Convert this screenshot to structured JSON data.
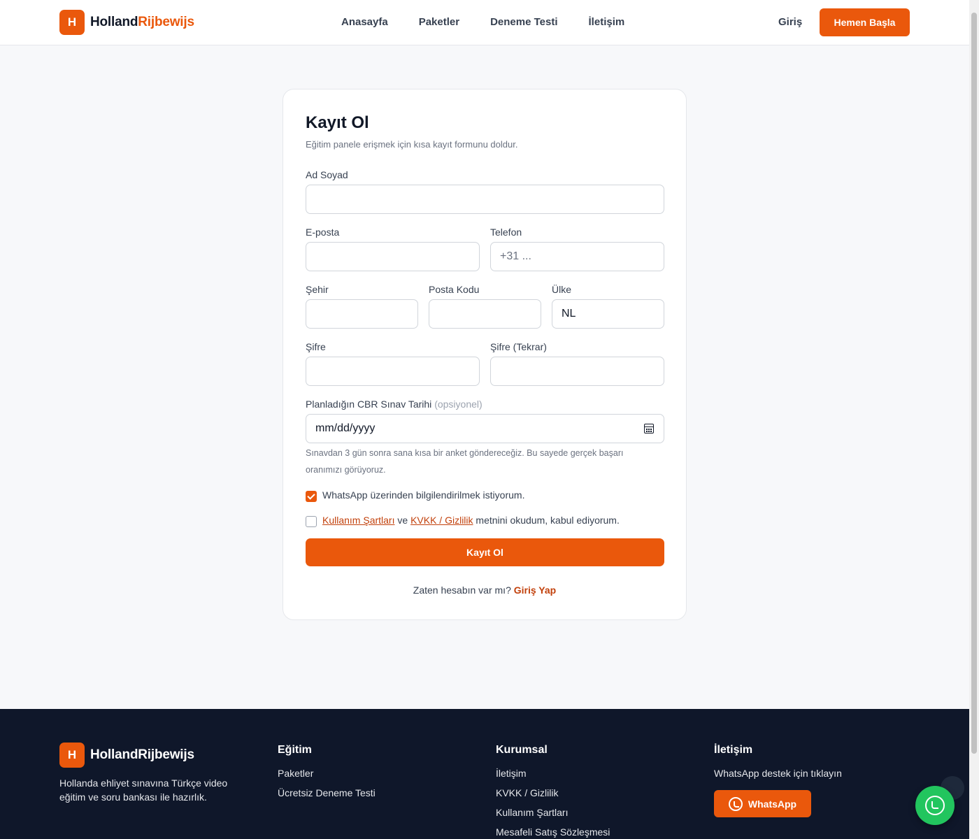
{
  "brand": {
    "logo_letter": "H",
    "name_main": "Holland",
    "name_accent": "Rijbewijs",
    "footer_name": "HollandRijbewijs",
    "accent_color": "#ea580c"
  },
  "nav": {
    "items": [
      "Anasayfa",
      "Paketler",
      "Deneme Testi",
      "İletişim"
    ],
    "login": "Giriş",
    "cta": "Hemen Başla"
  },
  "form": {
    "title": "Kayıt Ol",
    "subtitle": "Eğitim panele erişmek için kısa kayıt formunu doldur.",
    "name_label": "Ad Soyad",
    "email_label": "E-posta",
    "phone_label": "Telefon",
    "phone_placeholder": "+31 ...",
    "city_label": "Şehir",
    "postal_label": "Posta Kodu",
    "country_label": "Ülke",
    "country_value": "NL",
    "password_label": "Şifre",
    "password_repeat_label": "Şifre (Tekrar)",
    "exam_date_label": "Planladığın CBR Sınav Tarihi",
    "exam_date_optional": "(opsiyonel)",
    "exam_date_placeholder": "mm/dd/yyyy",
    "exam_date_help": "Sınavdan 3 gün sonra sana kısa bir anket göndereceğiz. Bu sayede gerçek başarı oranımızı görüyoruz.",
    "whatsapp_consent": "WhatsApp üzerinden bilgilendirilmek istiyorum.",
    "whatsapp_checked": true,
    "terms_link": "Kullanım Şartları",
    "terms_and": "ve",
    "privacy_link": "KVKK / Gizlilik",
    "terms_suffix": "metnini okudum, kabul ediyorum.",
    "terms_checked": false,
    "submit": "Kayıt Ol",
    "have_account": "Zaten hesabın var mı?",
    "login_link": "Giriş Yap"
  },
  "footer": {
    "description": "Hollanda ehliyet sınavına Türkçe video eğitim ve soru bankası ile hazırlık.",
    "col1": {
      "title": "Eğitim",
      "items": [
        "Paketler",
        "Ücretsiz Deneme Testi"
      ]
    },
    "col2": {
      "title": "Kurumsal",
      "items": [
        "İletişim",
        "KVKK / Gizlilik",
        "Kullanım Şartları",
        "Mesafeli Satış Sözleşmesi"
      ]
    },
    "col3": {
      "title": "İletişim",
      "text": "WhatsApp destek için tıklayın",
      "button": "WhatsApp"
    }
  }
}
